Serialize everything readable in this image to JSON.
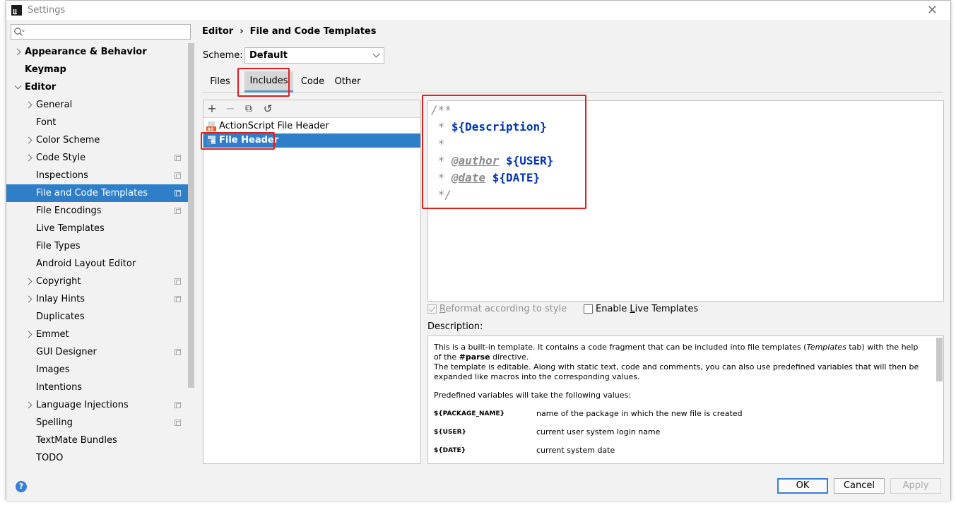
{
  "window": {
    "title": "Settings",
    "close_glyph": "✕"
  },
  "search": {
    "value": "",
    "placeholder": ""
  },
  "sidebar": {
    "items": [
      {
        "label": "Appearance & Behavior",
        "level": 0,
        "arrow": "right",
        "bold": true,
        "copy": false,
        "selected": false
      },
      {
        "label": "Keymap",
        "level": 0,
        "arrow": "none",
        "bold": true,
        "copy": false,
        "selected": false
      },
      {
        "label": "Editor",
        "level": 0,
        "arrow": "down",
        "bold": true,
        "copy": false,
        "selected": false
      },
      {
        "label": "General",
        "level": 1,
        "arrow": "right",
        "bold": false,
        "copy": false,
        "selected": false
      },
      {
        "label": "Font",
        "level": 1,
        "arrow": "none",
        "bold": false,
        "copy": false,
        "selected": false
      },
      {
        "label": "Color Scheme",
        "level": 1,
        "arrow": "right",
        "bold": false,
        "copy": false,
        "selected": false
      },
      {
        "label": "Code Style",
        "level": 1,
        "arrow": "right",
        "bold": false,
        "copy": true,
        "selected": false
      },
      {
        "label": "Inspections",
        "level": 1,
        "arrow": "none",
        "bold": false,
        "copy": true,
        "selected": false
      },
      {
        "label": "File and Code Templates",
        "level": 1,
        "arrow": "none",
        "bold": false,
        "copy": true,
        "selected": true
      },
      {
        "label": "File Encodings",
        "level": 1,
        "arrow": "none",
        "bold": false,
        "copy": true,
        "selected": false
      },
      {
        "label": "Live Templates",
        "level": 1,
        "arrow": "none",
        "bold": false,
        "copy": false,
        "selected": false
      },
      {
        "label": "File Types",
        "level": 1,
        "arrow": "none",
        "bold": false,
        "copy": false,
        "selected": false
      },
      {
        "label": "Android Layout Editor",
        "level": 1,
        "arrow": "none",
        "bold": false,
        "copy": false,
        "selected": false
      },
      {
        "label": "Copyright",
        "level": 1,
        "arrow": "right",
        "bold": false,
        "copy": true,
        "selected": false
      },
      {
        "label": "Inlay Hints",
        "level": 1,
        "arrow": "right",
        "bold": false,
        "copy": true,
        "selected": false
      },
      {
        "label": "Duplicates",
        "level": 1,
        "arrow": "none",
        "bold": false,
        "copy": false,
        "selected": false
      },
      {
        "label": "Emmet",
        "level": 1,
        "arrow": "right",
        "bold": false,
        "copy": false,
        "selected": false
      },
      {
        "label": "GUI Designer",
        "level": 1,
        "arrow": "none",
        "bold": false,
        "copy": true,
        "selected": false
      },
      {
        "label": "Images",
        "level": 1,
        "arrow": "none",
        "bold": false,
        "copy": false,
        "selected": false
      },
      {
        "label": "Intentions",
        "level": 1,
        "arrow": "none",
        "bold": false,
        "copy": false,
        "selected": false
      },
      {
        "label": "Language Injections",
        "level": 1,
        "arrow": "right",
        "bold": false,
        "copy": true,
        "selected": false
      },
      {
        "label": "Spelling",
        "level": 1,
        "arrow": "none",
        "bold": false,
        "copy": true,
        "selected": false
      },
      {
        "label": "TextMate Bundles",
        "level": 1,
        "arrow": "none",
        "bold": false,
        "copy": false,
        "selected": false
      },
      {
        "label": "TODO",
        "level": 1,
        "arrow": "none",
        "bold": false,
        "copy": false,
        "selected": false
      }
    ]
  },
  "breadcrumb": {
    "parent": "Editor",
    "separator": "›",
    "current": "File and Code Templates"
  },
  "scheme": {
    "label": "Scheme:",
    "value": "Default"
  },
  "tabs": [
    {
      "label": "Files",
      "active": false
    },
    {
      "label": "Includes",
      "active": true
    },
    {
      "label": "Code",
      "active": false
    },
    {
      "label": "Other",
      "active": false
    }
  ],
  "toolbar": {
    "add": "+",
    "remove": "−",
    "copy": "⧉",
    "reset": "↺"
  },
  "templates": [
    {
      "label": "ActionScript File Header",
      "icon": "actionscript-file-icon",
      "selected": false
    },
    {
      "label": "File Header",
      "icon": "java-file-icon",
      "selected": true
    }
  ],
  "editor": {
    "line1": "/**",
    "line2_prefix": " * ",
    "line2_var": "${Description}",
    "line3": " *",
    "line4_prefix": " * ",
    "line4_tag": "@author",
    "line4_var": "${USER}",
    "line5_prefix": " * ",
    "line5_tag": "@date",
    "line5_var": "${DATE}",
    "line6": " */"
  },
  "options": {
    "reformat_pre": "",
    "reformat_u": "R",
    "reformat_post": "eformat according to style",
    "reformat_checked": true,
    "live_pre": "Enable ",
    "live_u": "L",
    "live_post": "ive Templates",
    "live_checked": false
  },
  "description": {
    "label": "Description:",
    "p1_a": "This is a built-in template. It contains a code fragment that can be included into file templates (",
    "p1_em": "Templates",
    "p1_b": " tab) with the help of the ",
    "p1_strong": "#parse",
    "p1_c": " directive.",
    "p2": "The template is editable. Along with static text, code and comments, you can also use predefined variables that will then be expanded like macros into the corresponding values.",
    "p3": "Predefined variables will take the following values:",
    "vars": [
      {
        "name": "${PACKAGE_NAME}",
        "desc": "name of the package in which the new file is created"
      },
      {
        "name": "${USER}",
        "desc": "current user system login name"
      },
      {
        "name": "${DATE}",
        "desc": "current system date"
      }
    ]
  },
  "buttons": {
    "help": "?",
    "ok": "OK",
    "cancel": "Cancel",
    "apply": "Apply"
  },
  "colors": {
    "selection": "#2f7fc8",
    "highlight_box": "#e21d1d",
    "variable": "#0033b3"
  }
}
